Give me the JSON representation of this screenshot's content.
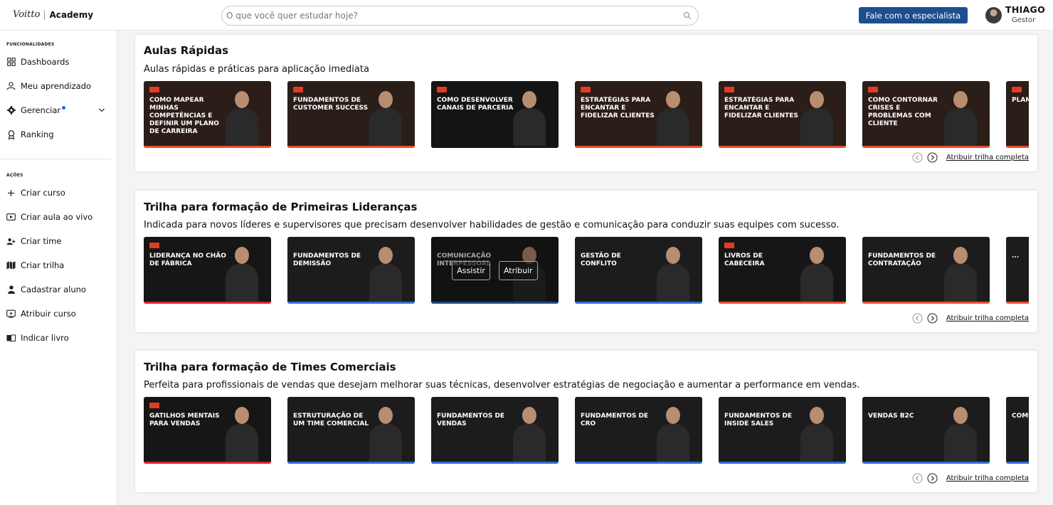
{
  "header": {
    "brand": "Voitto",
    "product": "Academy",
    "search_placeholder": "O que você quer estudar hoje?",
    "cta_label": "Fale com o especialista",
    "user_name": "THIAGO",
    "user_role": "Gestor"
  },
  "sidebar": {
    "section_features": "FUNCIONALIDADES",
    "features": [
      {
        "label": "Dashboards",
        "icon": "grid-icon"
      },
      {
        "label": "Meu aprendizado",
        "icon": "learning-icon"
      },
      {
        "label": "Gerenciar",
        "icon": "gear-icon"
      },
      {
        "label": "Ranking",
        "icon": "medal-icon"
      }
    ],
    "section_actions": "AÇÕES",
    "actions": [
      {
        "label": "Criar curso",
        "icon": "plus-icon"
      },
      {
        "label": "Criar aula ao vivo",
        "icon": "live-class-icon"
      },
      {
        "label": "Criar time",
        "icon": "team-icon"
      },
      {
        "label": "Criar trilha",
        "icon": "map-icon"
      },
      {
        "label": "Cadastrar aluno",
        "icon": "student-icon"
      },
      {
        "label": "Atribuir curso",
        "icon": "assign-icon"
      },
      {
        "label": "Indicar livro",
        "icon": "book-icon"
      }
    ]
  },
  "sections": [
    {
      "title": "Aulas Rápidas",
      "description": "Aulas rápidas e práticas para aplicação imediata",
      "cards": [
        {
          "title": "Como mapear minhas competências e definir um plano de carreira",
          "bg": "#2b1d18",
          "bar": "#e7512c"
        },
        {
          "title": "Fundamentos de customer success",
          "bg": "#2a1e19",
          "bar": "#e7512c"
        },
        {
          "title": "Como Desenvolver Canais de Parceria",
          "bg": "#141414",
          "bar": "#141414"
        },
        {
          "title": "Estratégias para encantar e fidelizar clientes",
          "bg": "#2b1d18",
          "bar": "#e7512c"
        },
        {
          "title": "Estratégias para encantar e fidelizar clientes",
          "bg": "#2b1d18",
          "bar": "#e7512c"
        },
        {
          "title": "Como contornar crises e problemas com cliente",
          "bg": "#2b1d18",
          "bar": "#e7512c"
        },
        {
          "title": "Plano de...",
          "bg": "#2b1d18",
          "bar": "#e7512c"
        }
      ],
      "link": "Atribuir trilha completa"
    },
    {
      "title": "Trilha para formação de Primeiras Lideranças",
      "description": "Indicada para novos líderes e supervisores que precisam desenvolver habilidades de gestão e comunicação para conduzir suas equipes com sucesso.",
      "cards": [
        {
          "title": "Liderança no Chão de Fábrica",
          "bg": "#161616",
          "bar": "#d8242f"
        },
        {
          "title": "Fundamentos de demissão",
          "bg": "#1c1c1c",
          "bar": "#2c6fd6"
        },
        {
          "title": "Comunicação interpessoal",
          "bg": "#1c1c1c",
          "bar": "#2c6fd6"
        },
        {
          "title": "Gestão de conflito",
          "bg": "#1c1c1c",
          "bar": "#2c6fd6"
        },
        {
          "title": "Livros de cabeceira",
          "bg": "#161616",
          "bar": "#e7512c"
        },
        {
          "title": "Fundamentos de contratação",
          "bg": "#1c1c1c",
          "bar": "#e7512c"
        },
        {
          "title": "...",
          "bg": "#1c1c1c",
          "bar": "#e7512c"
        }
      ],
      "hover": {
        "watch": "Assistir",
        "assign": "Atribuir"
      },
      "link": "Atribuir trilha completa"
    },
    {
      "title": "Trilha para formação de Times Comerciais",
      "description": "Perfeita para profissionais de vendas que desejam melhorar suas técnicas, desenvolver estratégias de negociação e aumentar a performance em vendas.",
      "cards": [
        {
          "title": "Gatilhos Mentais para Vendas",
          "bg": "#161616",
          "bar": "#d8242f"
        },
        {
          "title": "Estruturação de um time comercial",
          "bg": "#1c1c1c",
          "bar": "#2c6fd6"
        },
        {
          "title": "Fundamentos de vendas",
          "bg": "#1c1c1c",
          "bar": "#2c6fd6"
        },
        {
          "title": "Fundamentos de CRO",
          "bg": "#1c1c1c",
          "bar": "#2c6fd6"
        },
        {
          "title": "Fundamentos de inside sales",
          "bg": "#1c1c1c",
          "bar": "#2c6fd6"
        },
        {
          "title": "Vendas B2C",
          "bg": "#1c1c1c",
          "bar": "#2c6fd6"
        },
        {
          "title": "Como...",
          "bg": "#1c1c1c",
          "bar": "#2c6fd6"
        }
      ],
      "link": "Atribuir trilha completa"
    }
  ]
}
